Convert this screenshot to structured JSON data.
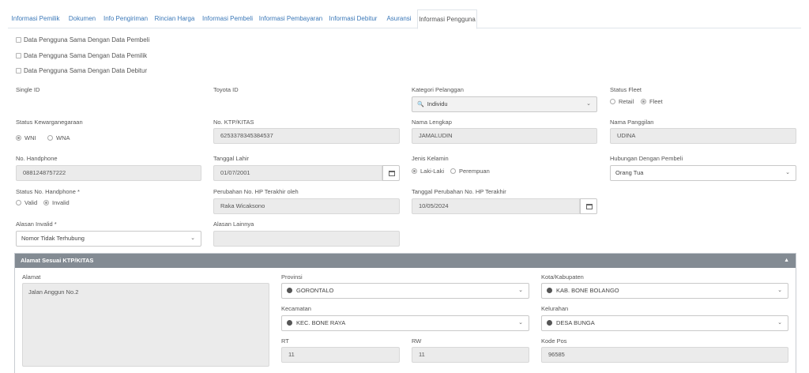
{
  "tabs": [
    {
      "label": "Informasi Pemilik"
    },
    {
      "label": "Dokumen"
    },
    {
      "label": "Info Pengiriman"
    },
    {
      "label": "Rincian Harga"
    },
    {
      "label": "Informasi Pembeli"
    },
    {
      "label": "Informasi Pembayaran"
    },
    {
      "label": "Informasi Debitur"
    },
    {
      "label": "Asuransi"
    },
    {
      "label": "Informasi Pengguna"
    }
  ],
  "checkboxes": [
    {
      "label": "Data Pengguna Sama Dengan Data Pembeli"
    },
    {
      "label": "Data Pengguna Sama Dengan Data Pemilik"
    },
    {
      "label": "Data Pengguna Sama Dengan Data Debitur"
    }
  ],
  "form": {
    "single_id": {
      "label": "Single ID"
    },
    "toyota_id": {
      "label": "Toyota ID"
    },
    "kategori": {
      "label": "Kategori Pelanggan",
      "value": "Individu"
    },
    "status_fleet": {
      "label": "Status Fleet",
      "options": [
        "Retail",
        "Fleet"
      ],
      "selected": "Fleet"
    },
    "kewarganegaraan": {
      "label": "Status Kewarganegaraan",
      "options": [
        "WNI",
        "WNA"
      ],
      "selected": "WNI"
    },
    "ktp": {
      "label": "No. KTP/KITAS",
      "value": "6253378345384537"
    },
    "nama_lengkap": {
      "label": "Nama Lengkap",
      "value": "JAMALUDIN"
    },
    "nama_panggilan": {
      "label": "Nama Panggilan",
      "value": "UDINA"
    },
    "handphone": {
      "label": "No. Handphone",
      "value": "0881248757222"
    },
    "tanggal_lahir": {
      "label": "Tanggal Lahir",
      "value": "01/07/2001"
    },
    "jenis_kelamin": {
      "label": "Jenis Kelamin",
      "options": [
        "Laki-Laki",
        "Perempuan"
      ],
      "selected": "Laki-Laki"
    },
    "hubungan": {
      "label": "Hubungan Dengan Pembeli",
      "value": "Orang Tua"
    },
    "status_hp": {
      "label": "Status No. Handphone *",
      "options": [
        "Valid",
        "Invalid"
      ],
      "selected": "Invalid"
    },
    "perubahan_oleh": {
      "label": "Perubahan No. HP Terakhir oleh",
      "value": "Raka Wicaksono"
    },
    "tanggal_perubahan": {
      "label": "Tanggal Perubahan No. HP Terakhir",
      "value": "10/05/2024"
    },
    "alasan_invalid": {
      "label": "Alasan Invalid *",
      "value": "Nomor Tidak Terhubung"
    },
    "alasan_lainnya": {
      "label": "Alasan Lainnya",
      "value": ""
    }
  },
  "address": {
    "title": "Alamat Sesuai KTP/KITAS",
    "alamat": {
      "label": "Alamat",
      "value": "Jalan Anggun No.2"
    },
    "provinsi": {
      "label": "Provinsi",
      "value": "GORONTALO"
    },
    "kota": {
      "label": "Kota/Kabupaten",
      "value": "KAB. BONE BOLANGO"
    },
    "kecamatan": {
      "label": "Kecamatan",
      "value": "KEC. BONE RAYA"
    },
    "kelurahan": {
      "label": "Kelurahan",
      "value": "DESA BUNGA"
    },
    "rt": {
      "label": "RT",
      "value": "11"
    },
    "rw": {
      "label": "RW",
      "value": "11"
    },
    "kode_pos": {
      "label": "Kode Pos",
      "value": "96585"
    }
  },
  "icons": {
    "search": "search-icon",
    "calendar": "calendar-icon",
    "globe": "globe-icon",
    "chevron": "chevron-down-icon",
    "collapse": "chevron-up-icon"
  },
  "colors": {
    "link": "#3b78b8",
    "panel_header": "#838b93",
    "readonly_bg": "#ebebeb"
  }
}
